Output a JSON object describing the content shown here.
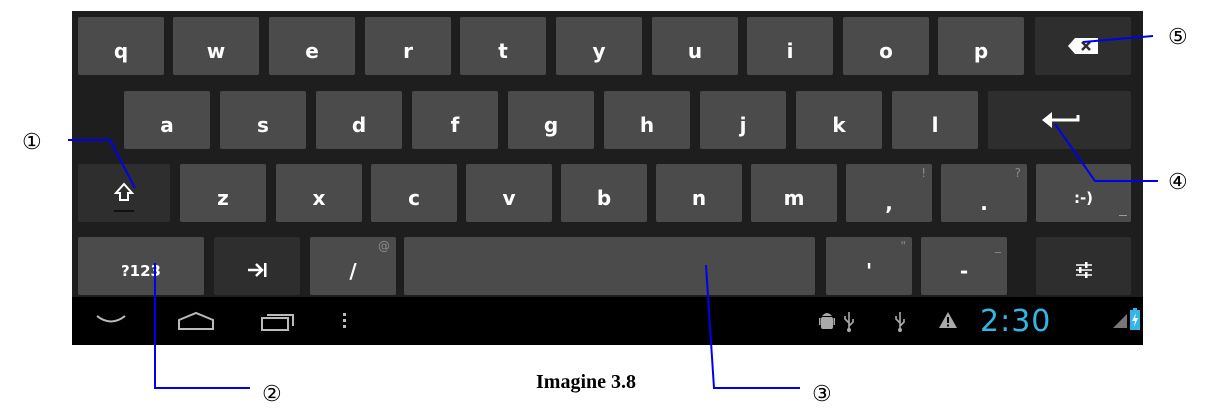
{
  "keyboard": {
    "row1": [
      "q",
      "w",
      "e",
      "r",
      "t",
      "y",
      "u",
      "i",
      "o",
      "p"
    ],
    "row2": [
      "a",
      "s",
      "d",
      "f",
      "g",
      "h",
      "j",
      "k",
      "l"
    ],
    "row3": [
      "z",
      "x",
      "c",
      "v",
      "b",
      "n",
      "m"
    ],
    "comma": ",",
    "comma_hint": "!",
    "period": ".",
    "period_hint": "?",
    "smiley": ":-)",
    "symbols_key": "?123",
    "slash": "/",
    "slash_hint": "@",
    "apostrophe": "'",
    "apostrophe_hint": "\"",
    "dash": "-",
    "dash_hint": "_"
  },
  "icons": {
    "backspace": "backspace-icon",
    "enter": "enter-icon",
    "shift": "shift-icon",
    "tab": "tab-icon",
    "settings": "settings-sliders-icon",
    "back": "nav-back-icon",
    "home": "nav-home-icon",
    "recent": "nav-recent-apps-icon",
    "menu": "nav-menu-icon",
    "debug": "android-debug-icon",
    "usb": "usb-icon",
    "warning": "warning-icon",
    "signal": "signal-icon",
    "battery": "battery-charging-icon"
  },
  "status": {
    "time": "2:30"
  },
  "callouts": {
    "c1": "①",
    "c2": "②",
    "c3": "③",
    "c4": "④",
    "c5": "⑤"
  },
  "caption": "Imagine 3.8",
  "colors": {
    "keyboard_bg": "#1e1e1e",
    "key": "#4b4b4b",
    "clock": "#33b5e5",
    "callout_line": "#0000ee",
    "battery": "#33b5e5"
  }
}
